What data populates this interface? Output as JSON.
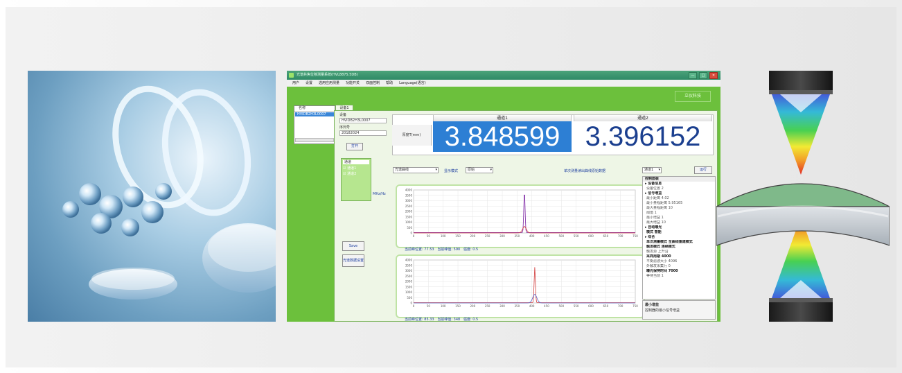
{
  "software": {
    "title_bar": "光谱共焦位移测量系统(HVL8875.5DB)",
    "window_buttons": [
      "—",
      "□",
      "✕"
    ],
    "menu": [
      "用户",
      "设置",
      "选用应用测量",
      "功能开关",
      "双面控制",
      "帮助",
      "Language(语言)"
    ],
    "brand_logo": "立仪科技",
    "device_list": {
      "header": "名称",
      "selected": "HVIDB2H3L0007"
    },
    "device_tab": "设备1",
    "device_info": {
      "device_label": "设备",
      "device_value": "HVIDB2H3L0007",
      "serial_label": "序列号",
      "serial_value": "20182024",
      "open_button": "打开"
    },
    "channel_select": {
      "header": "通道",
      "items": [
        "☑ 通道1",
        "☑ 通道2"
      ]
    },
    "save_button": "Save",
    "calibration_button": "光谱数据设置",
    "readout": {
      "row_label": "厚度T(mm)",
      "channel1_title": "通道1",
      "channel2_title": "通道2",
      "channel1_value": "3.848599",
      "channel2_value": "3.396152"
    },
    "controls": {
      "mode_select": "光谱曲线",
      "display_label": "显示模式",
      "display_select": "原始",
      "note": "单次测量读出曲线原始数据",
      "channel_label": "通道1",
      "run_button": "运行",
      "sample_rate_label": "MHz/Hz"
    },
    "charts": [
      {
        "status": [
          "当前峰位置: 77.53",
          "当前峰值: 590",
          "强度: 0.5"
        ]
      },
      {
        "status": [
          "当前峰位置: 85.33",
          "当前峰值: 348",
          "强度: 0.5"
        ]
      }
    ],
    "property_grid": {
      "toolbar": "控制面板",
      "rows": [
        {
          "kind": "grp",
          "text": "▸ 设备信息"
        },
        {
          "kind": "row",
          "text": "设备位置   2"
        },
        {
          "kind": "grp",
          "text": "▸ 信号增益"
        },
        {
          "kind": "row",
          "text": "最小距离    4.02"
        },
        {
          "kind": "row",
          "text": "最小量程距离  5.95165"
        },
        {
          "kind": "row",
          "text": "最大量程距离  10"
        },
        {
          "kind": "row",
          "text": "阈值       1"
        },
        {
          "kind": "row",
          "text": "最小增益    1"
        },
        {
          "kind": "row",
          "text": "最大增益    10"
        },
        {
          "kind": "grp",
          "text": "▸ 自动曝光"
        },
        {
          "kind": "bold",
          "text": "模式       智能"
        },
        {
          "kind": "grp",
          "text": "▸ 综合"
        },
        {
          "kind": "bold",
          "text": "单次测量模式  全曲线重建模式"
        },
        {
          "kind": "bold",
          "text": "触发模式    连续模式"
        },
        {
          "kind": "row",
          "text": "触发源     上升沿"
        },
        {
          "kind": "bold",
          "text": "采样周期    4000"
        },
        {
          "kind": "row",
          "text": "平衡滤波大小  4096"
        },
        {
          "kind": "row",
          "text": "外触发采集行 0"
        },
        {
          "kind": "bold",
          "text": "曝光保持时间  7000"
        },
        {
          "kind": "row",
          "text": "等待当前    1"
        }
      ],
      "desc_title": "最小增益",
      "desc_text": "控制器的最小信号增益"
    },
    "chart_data": [
      {
        "type": "line",
        "x_ticks": [
          0,
          50,
          100,
          150,
          200,
          250,
          300,
          350,
          400,
          450,
          500,
          550,
          600,
          650,
          700,
          750
        ],
        "y_ticks": [
          0,
          500,
          1000,
          1500,
          2000,
          2500,
          3000,
          3500,
          4000
        ],
        "xlim": [
          0,
          750
        ],
        "ylim": [
          0,
          4000
        ],
        "series": [
          {
            "color": "#7a1fa2",
            "peak_x": 375,
            "peak_y": 3900,
            "width": 3,
            "base": 40
          },
          {
            "color": "#d23b3b",
            "peak_x": 375,
            "peak_y": 600,
            "width": 9,
            "base": 0
          }
        ]
      },
      {
        "type": "line",
        "x_ticks": [
          0,
          50,
          100,
          150,
          200,
          250,
          300,
          350,
          400,
          450,
          500,
          550,
          600,
          650,
          700,
          750
        ],
        "y_ticks": [
          0,
          500,
          1000,
          1500,
          2000,
          2500,
          3000,
          3500,
          4000
        ],
        "xlim": [
          0,
          750
        ],
        "ylim": [
          0,
          4000
        ],
        "series": [
          {
            "color": "#d23b3b",
            "peak_x": 410,
            "peak_y": 3300,
            "width": 3,
            "base": 30
          },
          {
            "color": "#5560c8",
            "peak_x": 410,
            "peak_y": 800,
            "width": 10,
            "base": 0
          }
        ]
      }
    ]
  },
  "colors": {
    "app_green": "#6cc03c",
    "readout_blue": "#2d7fd4",
    "readout_text_dark": "#1b3f8f",
    "lens_top": "#7fb98a",
    "lens_bottom": "#c9ced3"
  }
}
